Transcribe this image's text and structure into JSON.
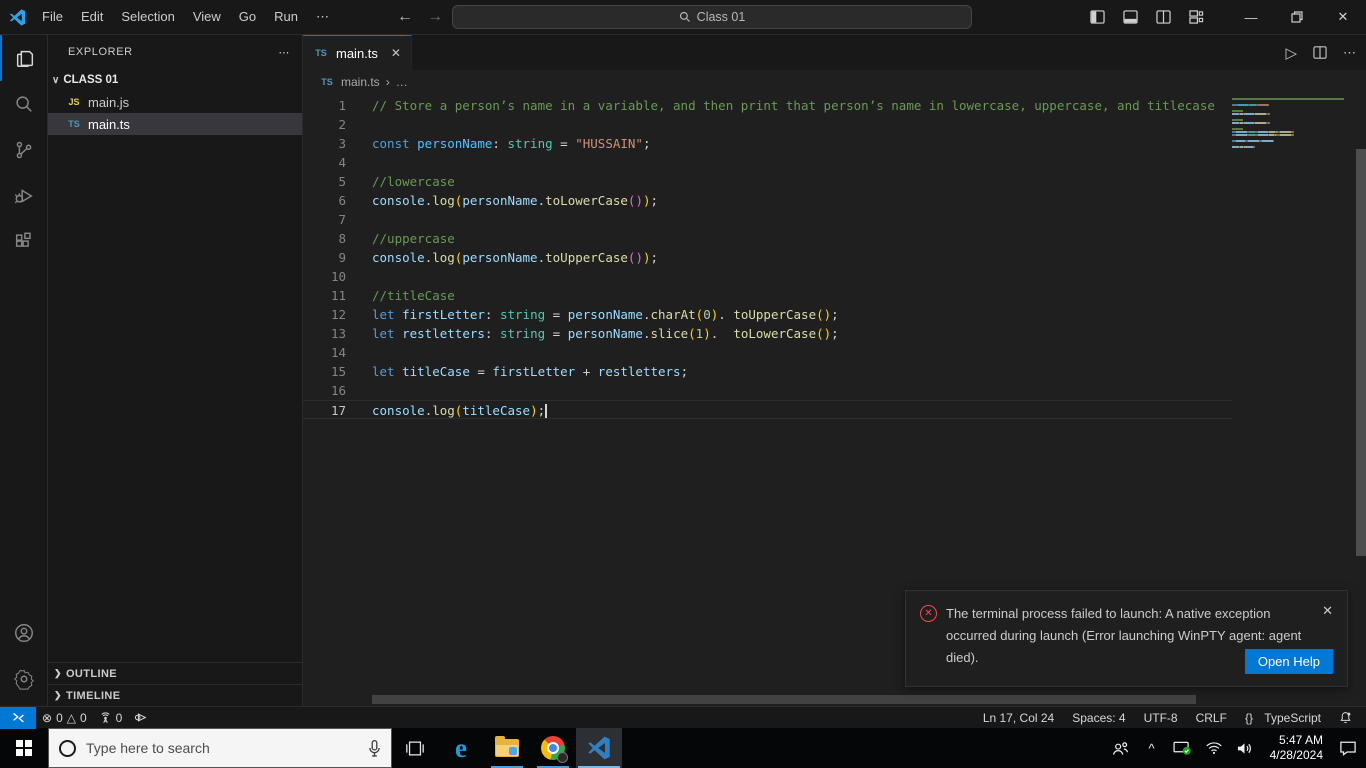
{
  "title_bar": {
    "menus": [
      "File",
      "Edit",
      "Selection",
      "View",
      "Go",
      "Run",
      "⋯"
    ],
    "back_arrow": "←",
    "forward_arrow": "→",
    "search": "Class 01",
    "minimize": "—",
    "close": "✕"
  },
  "activity_bar": {
    "items": [
      "explorer",
      "search",
      "source-control",
      "run-debug",
      "extensions"
    ],
    "bottom": [
      "account",
      "settings"
    ]
  },
  "sidebar": {
    "header": "EXPLORER",
    "header_actions": "⋯",
    "folder_chevron": "∨",
    "folder": "CLASS 01",
    "files": [
      {
        "icon": "JS",
        "type": "js",
        "name": "main.js",
        "selected": false
      },
      {
        "icon": "TS",
        "type": "ts",
        "name": "main.ts",
        "selected": true
      }
    ],
    "section_chevron": "❯",
    "sections": [
      "OUTLINE",
      "TIMELINE"
    ]
  },
  "editor": {
    "tab": {
      "icon": "TS",
      "label": "main.ts",
      "close": "✕"
    },
    "breadcrumb_file": "main.ts",
    "breadcrumb_sep": "›",
    "breadcrumb_more": "…",
    "actions": {
      "run": "▷",
      "more": "⋯"
    },
    "current_line": 17,
    "code_lines": [
      {
        "num": 1,
        "tokens": [
          {
            "c": "cm",
            "t": "// Store a person’s name in a variable, and then print that person’s name in lowercase, uppercase, and titlecase"
          }
        ]
      },
      {
        "num": 2,
        "tokens": []
      },
      {
        "num": 3,
        "tokens": [
          {
            "c": "kw",
            "t": "const "
          },
          {
            "c": "cvar",
            "t": "personName"
          },
          {
            "c": "pun",
            "t": ": "
          },
          {
            "c": "type",
            "t": "string"
          },
          {
            "c": "pun",
            "t": " = "
          },
          {
            "c": "str",
            "t": "\"HUSSAIN\""
          },
          {
            "c": "pun",
            "t": ";"
          }
        ]
      },
      {
        "num": 4,
        "tokens": []
      },
      {
        "num": 5,
        "tokens": [
          {
            "c": "cm",
            "t": "//lowercase"
          }
        ]
      },
      {
        "num": 6,
        "tokens": [
          {
            "c": "var",
            "t": "console"
          },
          {
            "c": "pun",
            "t": "."
          },
          {
            "c": "fn",
            "t": "log"
          },
          {
            "c": "p1",
            "t": "("
          },
          {
            "c": "var",
            "t": "personName"
          },
          {
            "c": "pun",
            "t": "."
          },
          {
            "c": "fn",
            "t": "toLowerCase"
          },
          {
            "c": "p2",
            "t": "()"
          },
          {
            "c": "p1",
            "t": ")"
          },
          {
            "c": "pun",
            "t": ";"
          }
        ]
      },
      {
        "num": 7,
        "tokens": []
      },
      {
        "num": 8,
        "tokens": [
          {
            "c": "cm",
            "t": "//uppercase"
          }
        ]
      },
      {
        "num": 9,
        "tokens": [
          {
            "c": "var",
            "t": "console"
          },
          {
            "c": "pun",
            "t": "."
          },
          {
            "c": "fn",
            "t": "log"
          },
          {
            "c": "p1",
            "t": "("
          },
          {
            "c": "var",
            "t": "personName"
          },
          {
            "c": "pun",
            "t": "."
          },
          {
            "c": "fn",
            "t": "toUpperCase"
          },
          {
            "c": "p2",
            "t": "()"
          },
          {
            "c": "p1",
            "t": ")"
          },
          {
            "c": "pun",
            "t": ";"
          }
        ]
      },
      {
        "num": 10,
        "tokens": []
      },
      {
        "num": 11,
        "tokens": [
          {
            "c": "cm",
            "t": "//titleCase"
          }
        ]
      },
      {
        "num": 12,
        "tokens": [
          {
            "c": "kw",
            "t": "let "
          },
          {
            "c": "var",
            "t": "firstLetter"
          },
          {
            "c": "pun",
            "t": ": "
          },
          {
            "c": "type",
            "t": "string"
          },
          {
            "c": "pun",
            "t": " = "
          },
          {
            "c": "var",
            "t": "personName"
          },
          {
            "c": "pun",
            "t": "."
          },
          {
            "c": "fn",
            "t": "charAt"
          },
          {
            "c": "p1",
            "t": "("
          },
          {
            "c": "num",
            "t": "0"
          },
          {
            "c": "p1",
            "t": ")"
          },
          {
            "c": "pun",
            "t": ". "
          },
          {
            "c": "fn",
            "t": "toUpperCase"
          },
          {
            "c": "p1",
            "t": "()"
          },
          {
            "c": "pun",
            "t": ";"
          }
        ]
      },
      {
        "num": 13,
        "tokens": [
          {
            "c": "kw",
            "t": "let "
          },
          {
            "c": "var",
            "t": "restletters"
          },
          {
            "c": "pun",
            "t": ": "
          },
          {
            "c": "type",
            "t": "string"
          },
          {
            "c": "pun",
            "t": " = "
          },
          {
            "c": "var",
            "t": "personName"
          },
          {
            "c": "pun",
            "t": "."
          },
          {
            "c": "fn",
            "t": "slice"
          },
          {
            "c": "p1",
            "t": "("
          },
          {
            "c": "num",
            "t": "1"
          },
          {
            "c": "p1",
            "t": ")"
          },
          {
            "c": "pun",
            "t": ".  "
          },
          {
            "c": "fn",
            "t": "toLowerCase"
          },
          {
            "c": "p1",
            "t": "()"
          },
          {
            "c": "pun",
            "t": ";"
          }
        ]
      },
      {
        "num": 14,
        "tokens": []
      },
      {
        "num": 15,
        "tokens": [
          {
            "c": "kw",
            "t": "let "
          },
          {
            "c": "var",
            "t": "titleCase"
          },
          {
            "c": "pun",
            "t": " = "
          },
          {
            "c": "var",
            "t": "firstLetter"
          },
          {
            "c": "pun",
            "t": " + "
          },
          {
            "c": "var",
            "t": "restletters"
          },
          {
            "c": "pun",
            "t": ";"
          }
        ]
      },
      {
        "num": 16,
        "tokens": []
      },
      {
        "num": 17,
        "cursor": true,
        "tokens": [
          {
            "c": "var",
            "t": "console"
          },
          {
            "c": "pun",
            "t": "."
          },
          {
            "c": "fn",
            "t": "log"
          },
          {
            "c": "p1",
            "t": "("
          },
          {
            "c": "var",
            "t": "titleCase"
          },
          {
            "c": "p1",
            "t": ")"
          },
          {
            "c": "pun",
            "t": ";"
          }
        ]
      }
    ]
  },
  "notification": {
    "message": "The terminal process failed to launch: A native exception occurred during launch (Error launching WinPTY agent: agent died).",
    "close": "✕",
    "button": "Open Help"
  },
  "status_bar": {
    "errors_icon": "⊗",
    "errors": "0",
    "warnings_icon": "△",
    "warnings": "0",
    "ports": "0",
    "line_col": "Ln 17, Col 24",
    "spaces": "Spaces: 4",
    "encoding": "UTF-8",
    "eol": "CRLF",
    "lang_braces": "{}",
    "language": "TypeScript"
  },
  "taskbar": {
    "search_placeholder": "Type here to search",
    "hidden_icons_chevron": "^",
    "time": "5:47 AM",
    "date": "4/28/2024"
  },
  "syntax_colors": {
    "cm": "#6a9955",
    "kw": "#569cd6",
    "var": "#9cdcfe",
    "cvar": "#4fc1ff",
    "type": "#4ec9b0",
    "str": "#ce9178",
    "fn": "#dcdcaa",
    "num": "#b5cea8",
    "pun": "#8a8a8a",
    "p1": "#b09a2f",
    "p2": "#a85fa0"
  },
  "colors": {
    "accent": "#0078d4",
    "error": "#f14c4c",
    "tab_border": "#0078d4"
  }
}
